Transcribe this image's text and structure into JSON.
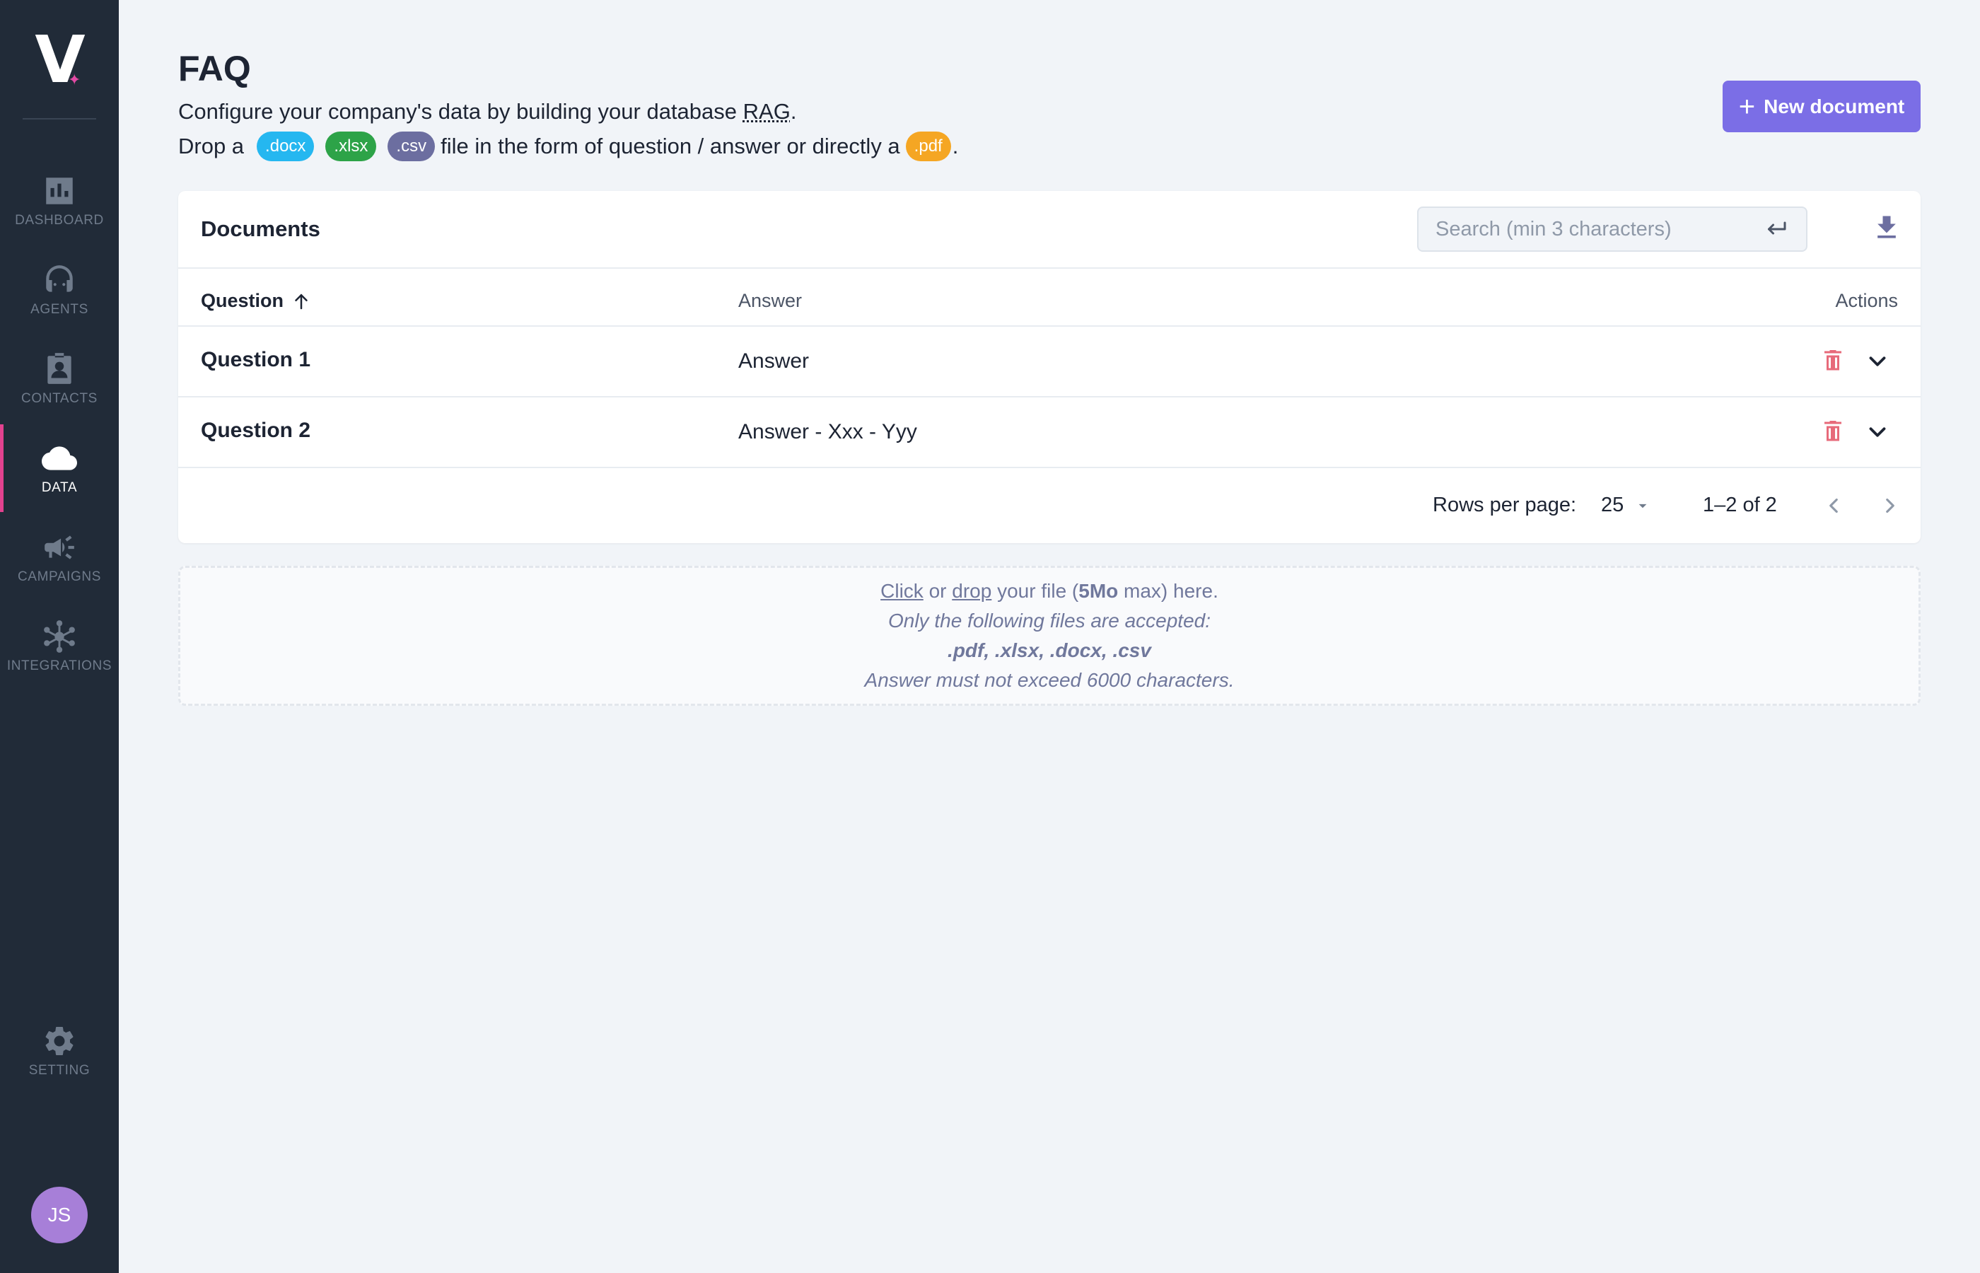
{
  "sidebar": {
    "logo_letter": "V",
    "items": [
      {
        "label": "DASHBOARD"
      },
      {
        "label": "AGENTS"
      },
      {
        "label": "CONTACTS"
      },
      {
        "label": "DATA"
      },
      {
        "label": "CAMPAIGNS"
      },
      {
        "label": "INTEGRATIONS"
      }
    ],
    "setting": {
      "label": "SETTING"
    },
    "avatar_initials": "JS"
  },
  "header": {
    "title": "FAQ",
    "desc_line1_pre": "Configure your company's data by building your database ",
    "desc_line1_abbr": "RAG",
    "desc_line1_post": ".",
    "desc_line2_pre": "Drop a",
    "chips": {
      "docx": ".docx",
      "xlsx": ".xlsx",
      "csv": ".csv",
      "pdf": ".pdf"
    },
    "desc_line2_mid": "file in the form of question / answer or directly a",
    "desc_line2_post": ".",
    "new_document_label": "New document"
  },
  "documents": {
    "title": "Documents",
    "search_placeholder": "Search (min 3 characters)",
    "columns": {
      "question": "Question",
      "answer": "Answer",
      "actions": "Actions"
    },
    "rows": [
      {
        "question": "Question 1",
        "answer": "Answer"
      },
      {
        "question": "Question 2",
        "answer": "Answer - Xxx - Yyy"
      }
    ],
    "footer": {
      "rows_per_page_label": "Rows per page:",
      "rows_per_page_value": "25",
      "range": "1–2 of 2"
    }
  },
  "dropzone": {
    "click": "Click",
    "or": "or",
    "drop": "drop",
    "your_file": "your file (",
    "max_size": "5Mo",
    "max_here": "max) here.",
    "accepted_label": "Only the following files are accepted:",
    "accepted_types": ".pdf, .xlsx, .docx, .csv",
    "limit_note": "Answer must not exceed 6000 characters."
  },
  "colors": {
    "sidebar_bg": "#212b38",
    "active_indicator": "#e2428f",
    "primary_button": "#7b6ee6",
    "trash": "#e45a6b"
  },
  "icons": {
    "dashboard": "bar-chart-icon",
    "agents": "headset-icon",
    "contacts": "contact-card-icon",
    "data": "cloud-icon",
    "campaigns": "megaphone-icon",
    "integrations": "network-icon",
    "setting": "gear-icon"
  }
}
